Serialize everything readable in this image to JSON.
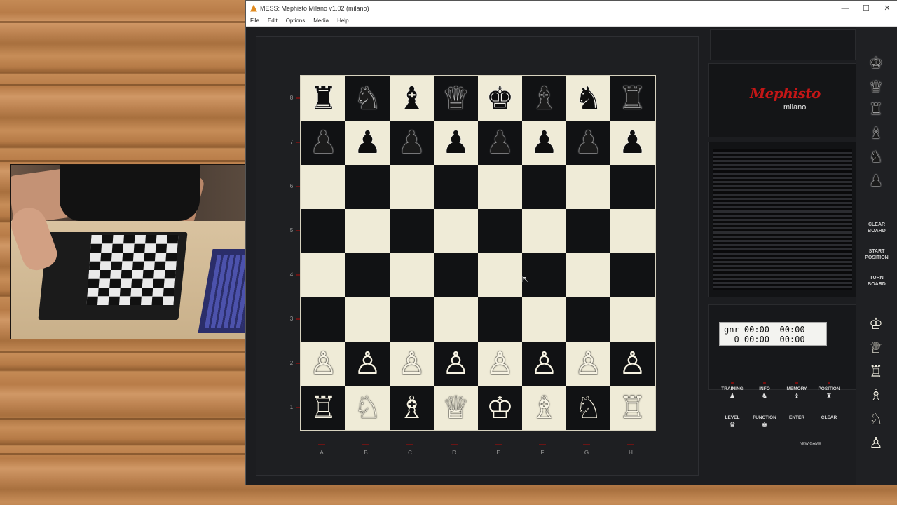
{
  "window": {
    "title": "MESS: Mephisto Milano v1.02 (milano)",
    "controls": {
      "minimize": "—",
      "maximize": "☐",
      "close": "✕"
    }
  },
  "menu": [
    "File",
    "Edit",
    "Options",
    "Media",
    "Help"
  ],
  "board": {
    "ranks": [
      "8",
      "7",
      "6",
      "5",
      "4",
      "3",
      "2",
      "1"
    ],
    "files": [
      "A",
      "B",
      "C",
      "D",
      "E",
      "F",
      "G",
      "H"
    ],
    "squares": [
      [
        "♜",
        "♞",
        "♝",
        "♛",
        "♚",
        "♝",
        "♞",
        "♜"
      ],
      [
        "♟",
        "♟",
        "♟",
        "♟",
        "♟",
        "♟",
        "♟",
        "♟"
      ],
      [
        "",
        "",
        "",
        "",
        "",
        "",
        "",
        ""
      ],
      [
        "",
        "",
        "",
        "",
        "",
        "",
        "",
        ""
      ],
      [
        "",
        "",
        "",
        "",
        "",
        "",
        "",
        ""
      ],
      [
        "",
        "",
        "",
        "",
        "",
        "",
        "",
        ""
      ],
      [
        "♙",
        "♙",
        "♙",
        "♙",
        "♙",
        "♙",
        "♙",
        "♙"
      ],
      [
        "♖",
        "♘",
        "♗",
        "♕",
        "♔",
        "♗",
        "♘",
        "♖"
      ]
    ]
  },
  "panel": {
    "logo": "Mephisto",
    "logo_sub": "milano",
    "lcd_line1": "gnr 00:00  00:00",
    "lcd_line2": "  0 00:00  00:00",
    "buttons_row1": [
      {
        "label": "TRAINING",
        "glyph": "♟"
      },
      {
        "label": "INFO",
        "glyph": "♞"
      },
      {
        "label": "MEMORY",
        "glyph": "♝"
      },
      {
        "label": "POSITION",
        "glyph": "♜"
      }
    ],
    "buttons_row2": [
      {
        "label": "LEVEL",
        "glyph": "♛"
      },
      {
        "label": "FUNCTION",
        "glyph": "♚"
      },
      {
        "label": "ENTER",
        "glyph": ""
      },
      {
        "label": "CLEAR",
        "glyph": ""
      }
    ],
    "new_game_label": "NEW GAME"
  },
  "sidebar": {
    "top_pieces": [
      "♚",
      "♛",
      "♜",
      "♝",
      "♞",
      "♟"
    ],
    "buttons": [
      "CLEAR BOARD",
      "START POSITION",
      "TURN BOARD"
    ],
    "bottom_pieces": [
      "♔",
      "♕",
      "♖",
      "♗",
      "♘",
      "♙"
    ]
  }
}
